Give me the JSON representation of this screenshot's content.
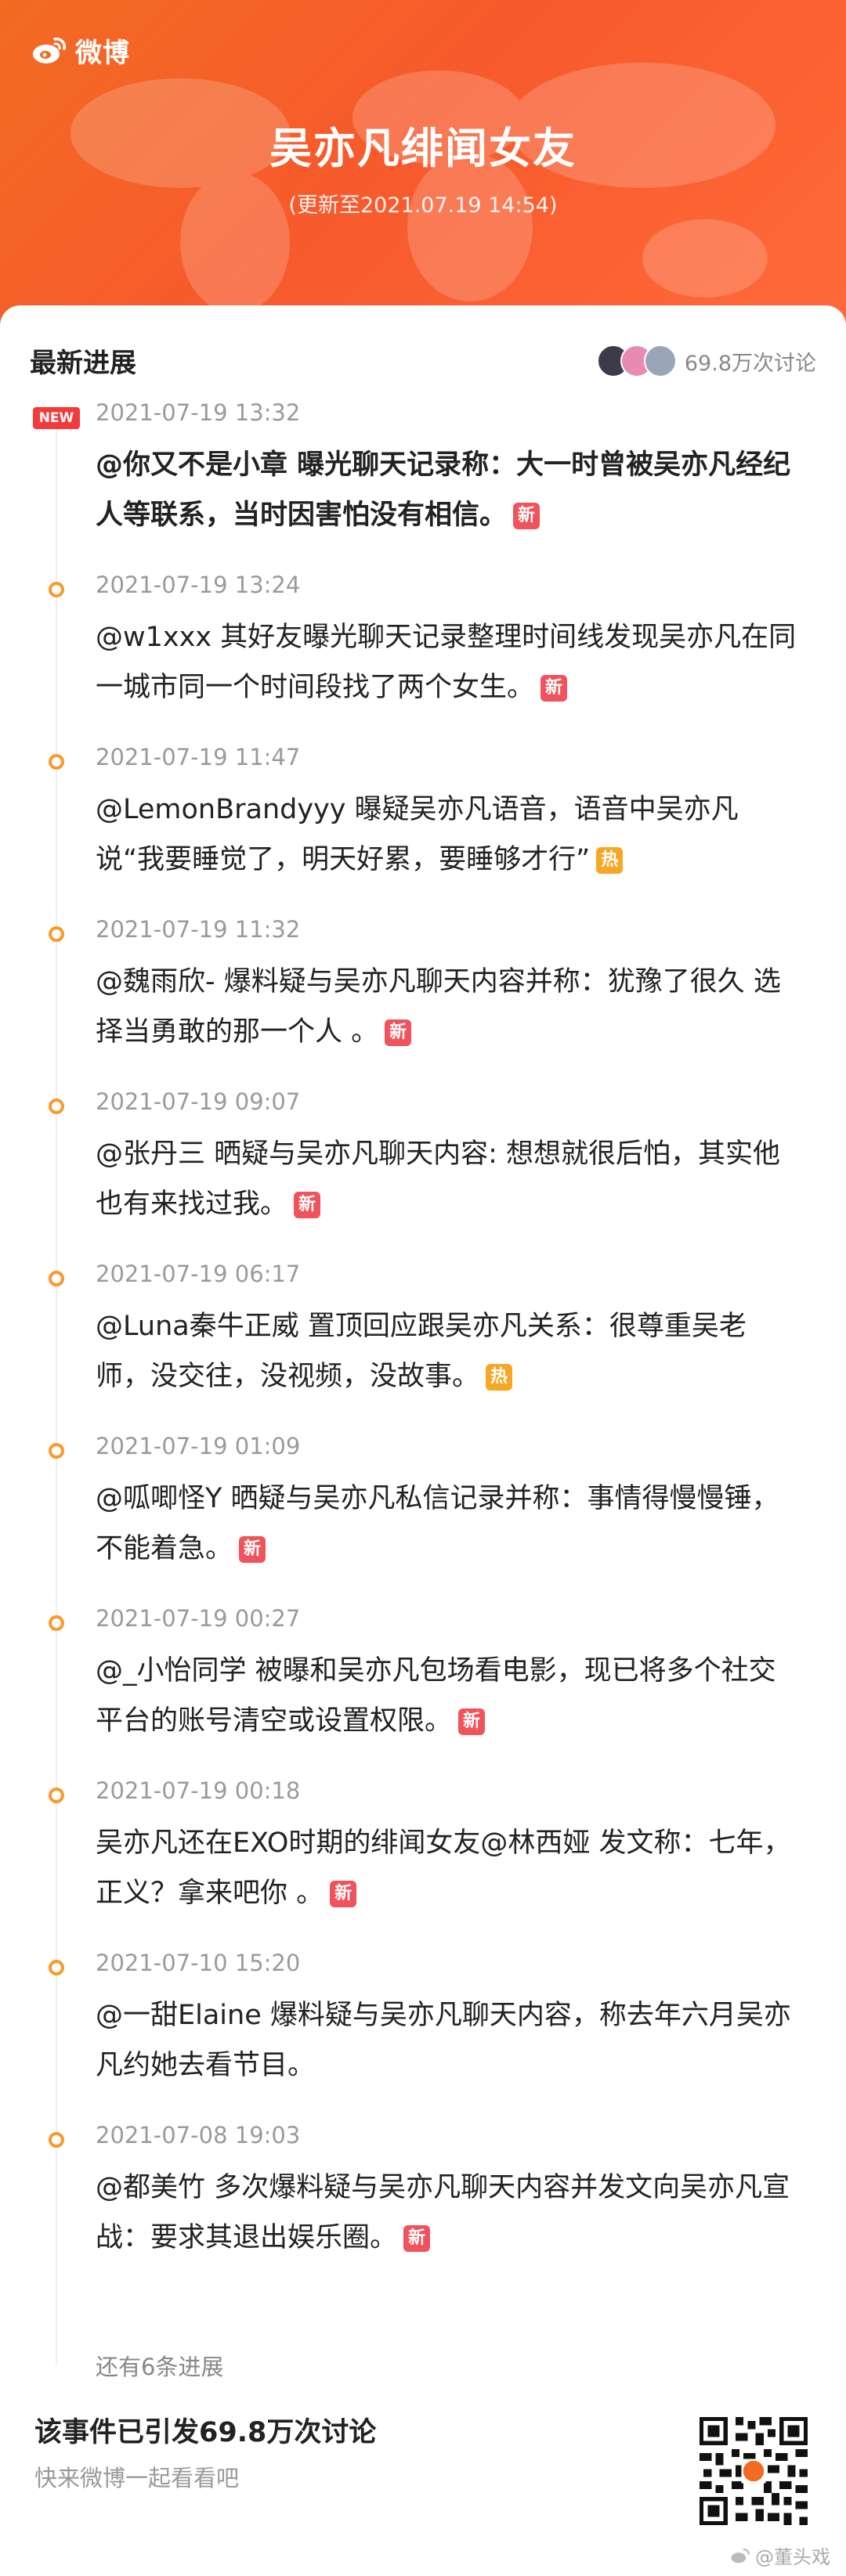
{
  "header": {
    "brand": "微博",
    "title": "吴亦凡绯闻女友",
    "updated": "(更新至2021.07.19 14:54)"
  },
  "progress": {
    "title": "最新进展",
    "discussion_count": "69.8万次讨论",
    "colors": {
      "accent": "#f99a2a",
      "new": "#f0535b",
      "hot": "#f6a723",
      "badge": "#f43a3a"
    }
  },
  "timeline": [
    {
      "time": "2021-07-19 13:32",
      "text": "@你又不是小章 曝光聊天记录称：大一时曾被吴亦凡经纪人等联系，当时因害怕没有相信。",
      "tag": "新",
      "tag_type": "new",
      "badge": "NEW",
      "bold": true
    },
    {
      "time": "2021-07-19 13:24",
      "text": "@w1xxx 其好友曝光聊天记录整理时间线发现吴亦凡在同一城市同一个时间段找了两个女生。",
      "tag": "新",
      "tag_type": "new"
    },
    {
      "time": "2021-07-19 11:47",
      "text": "@LemonBrandyyy 曝疑吴亦凡语音，语音中吴亦凡说“我要睡觉了，明天好累，要睡够才行”",
      "tag": "热",
      "tag_type": "hot"
    },
    {
      "time": "2021-07-19 11:32",
      "text": "@魏雨欣- 爆料疑与吴亦凡聊天内容并称：犹豫了很久 选择当勇敢的那一个人 。",
      "tag": "新",
      "tag_type": "new"
    },
    {
      "time": "2021-07-19 09:07",
      "text": "@张丹三 晒疑与吴亦凡聊天内容: 想想就很后怕，其实他也有来找过我。",
      "tag": "新",
      "tag_type": "new"
    },
    {
      "time": "2021-07-19 06:17",
      "text": "@Luna秦牛正威 置顶回应跟吴亦凡关系：很尊重吴老师，没交往，没视频，没故事。",
      "tag": "热",
      "tag_type": "hot"
    },
    {
      "time": "2021-07-19 01:09",
      "text": "@呱唧怪Y 晒疑与吴亦凡私信记录并称：事情得慢慢锤，不能着急。",
      "tag": "新",
      "tag_type": "new"
    },
    {
      "time": "2021-07-19 00:27",
      "text": "@_小怡同学 被曝和吴亦凡包场看电影，现已将多个社交平台的账号清空或设置权限。",
      "tag": "新",
      "tag_type": "new"
    },
    {
      "time": "2021-07-19 00:18",
      "text": "吴亦凡还在EXO时期的绯闻女友@林西娅 发文称：七年，正义？拿来吧你 。",
      "tag": "新",
      "tag_type": "new"
    },
    {
      "time": "2021-07-10 15:20",
      "text": "@一甜Elaine 爆料疑与吴亦凡聊天内容，称去年六月吴亦凡约她去看节目。",
      "tag": "",
      "tag_type": ""
    },
    {
      "time": "2021-07-08 19:03",
      "text": "@都美竹 多次爆料疑与吴亦凡聊天内容并发文向吴亦凡宣战：要求其退出娱乐圈。",
      "tag": "新",
      "tag_type": "new"
    }
  ],
  "more_label": "还有6条进展",
  "footer": {
    "title": "该事件已引发69.8万次讨论",
    "subtitle": "快来微博一起看看吧"
  },
  "watermark": "@董头戏"
}
